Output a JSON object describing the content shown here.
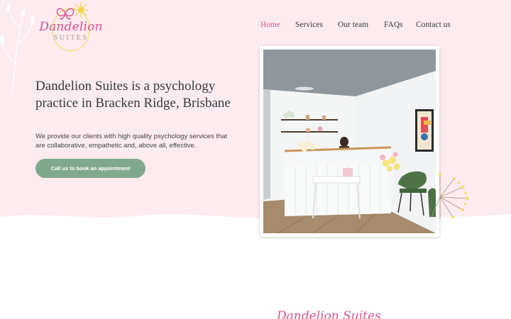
{
  "brand": {
    "name": "Dandelion",
    "suffix": "SUITES",
    "accent": "#d6548f"
  },
  "nav": {
    "items": [
      {
        "label": "Home",
        "active": true
      },
      {
        "label": "Services"
      },
      {
        "label": "Our team"
      },
      {
        "label": "FAQs"
      },
      {
        "label": "Contact us"
      }
    ]
  },
  "hero": {
    "headline": "Dandelion Suites is a psychology practice in Bracken Ridge, Brisbane",
    "intro": "We provide our clients with high quality psychology services that are collaborative, empathetic and, above all, effective.",
    "cta_label": "Call us to book an appointment",
    "background": "#fcebef",
    "button_color": "#7fa98c"
  },
  "next_section": {
    "script_title": "Dandelion Suites"
  }
}
